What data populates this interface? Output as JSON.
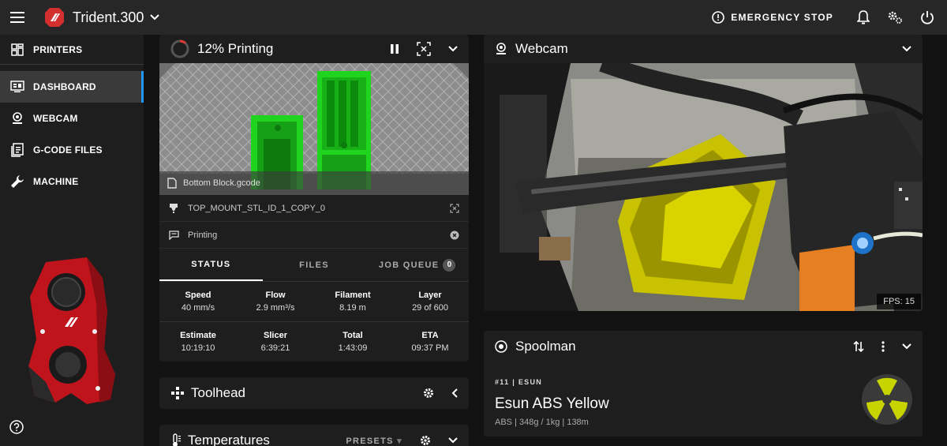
{
  "app": {
    "title": "Trident.300"
  },
  "header": {
    "emergency_stop": "EMERGENCY STOP"
  },
  "sidebar": {
    "items": [
      {
        "label": "PRINTERS",
        "icon": "printers-icon"
      },
      {
        "label": "DASHBOARD",
        "icon": "dashboard-icon"
      },
      {
        "label": "WEBCAM",
        "icon": "webcam-icon"
      },
      {
        "label": "G-CODE FILES",
        "icon": "file-icon"
      },
      {
        "label": "MACHINE",
        "icon": "wrench-icon"
      }
    ],
    "active": "DASHBOARD"
  },
  "print_status": {
    "title": "12% Printing",
    "progress": 0.12,
    "file": "Bottom Block.gcode",
    "object": "TOP_MOUNT_STL_ID_1_COPY_0",
    "state": "Printing",
    "tabs": [
      {
        "label": "STATUS"
      },
      {
        "label": "FILES"
      },
      {
        "label": "JOB QUEUE",
        "badge": "0"
      }
    ],
    "stats": [
      {
        "label": "Speed",
        "value": "40 mm/s"
      },
      {
        "label": "Flow",
        "value": "2.9 mm³/s"
      },
      {
        "label": "Filament",
        "value": "8.19 m"
      },
      {
        "label": "Layer",
        "value": "29 of 600"
      },
      {
        "label": "Estimate",
        "value": "10:19:10"
      },
      {
        "label": "Slicer",
        "value": "6:39:21"
      },
      {
        "label": "Total",
        "value": "1:43:09"
      },
      {
        "label": "ETA",
        "value": "09:37 PM"
      }
    ]
  },
  "toolhead": {
    "title": "Toolhead"
  },
  "temperatures": {
    "title": "Temperatures",
    "presets": "PRESETS"
  },
  "webcam": {
    "title": "Webcam",
    "fps": "FPS: 15"
  },
  "spoolman": {
    "title": "Spoolman",
    "spool_id": "#11 | ESUN",
    "name": "Esun ABS Yellow",
    "meta": "ABS | 348g / 1kg | 138m",
    "color": "#c8d400"
  },
  "colors": {
    "accent": "#2196f3",
    "brand": "#d32f2f",
    "print_green": "#22cc22"
  }
}
